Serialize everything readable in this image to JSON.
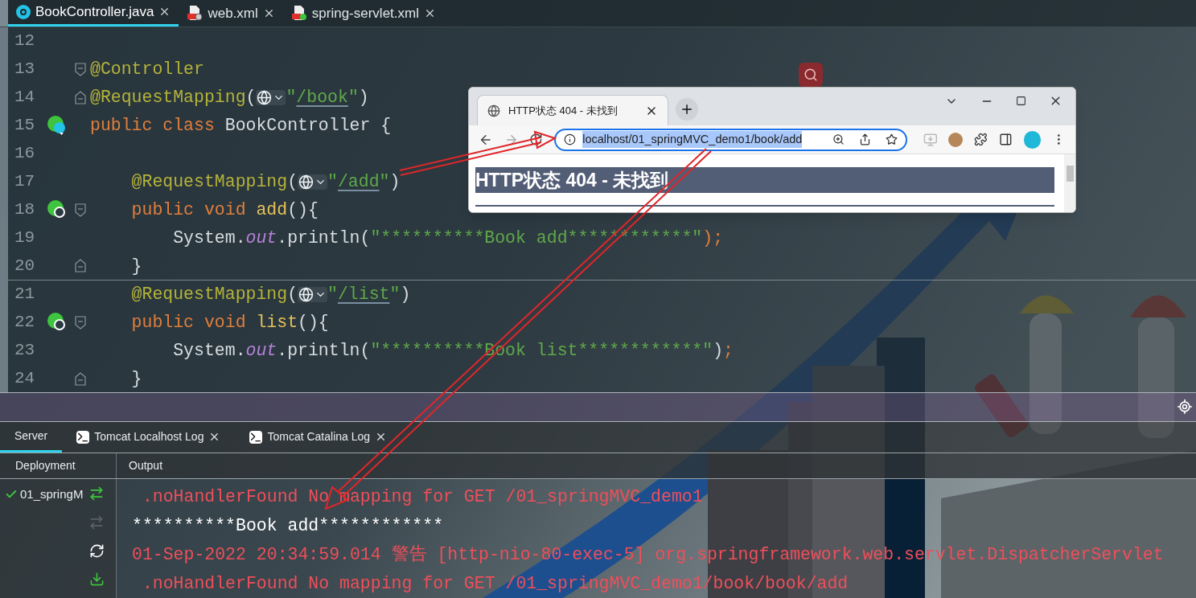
{
  "editor_tabs": [
    {
      "label": "BookController.java",
      "kind": "java",
      "selected": true
    },
    {
      "label": "web.xml",
      "kind": "web-xml",
      "selected": false
    },
    {
      "label": "spring-servlet.xml",
      "kind": "spring-xml",
      "selected": false
    }
  ],
  "code_lines": [
    {
      "number": "12"
    },
    {
      "number": "13",
      "fold": {
        "kind": "start"
      },
      "tokens": [
        {
          "kind": "annotation",
          "text": "@Controller"
        }
      ]
    },
    {
      "number": "14",
      "fold": {
        "kind": "end"
      },
      "tokens": [
        {
          "kind": "annotation",
          "text": "@RequestMapping"
        },
        {
          "kind": "plain",
          "text": "("
        },
        {
          "kind": "globe"
        },
        {
          "kind": "string",
          "text": "\""
        },
        {
          "kind": "link",
          "text": "/book"
        },
        {
          "kind": "string",
          "text": "\""
        },
        {
          "kind": "plain",
          "text": ")"
        }
      ]
    },
    {
      "number": "15",
      "gutter_icon": {
        "kind": "class"
      },
      "tokens": [
        {
          "kind": "keyword",
          "text": "public class "
        },
        {
          "kind": "plain",
          "text": "BookController {"
        }
      ]
    },
    {
      "number": "16"
    },
    {
      "number": "17",
      "tokens": [
        {
          "kind": "annotation",
          "text": "    @RequestMapping"
        },
        {
          "kind": "plain",
          "text": "("
        },
        {
          "kind": "globe"
        },
        {
          "kind": "string",
          "text": "\""
        },
        {
          "kind": "link",
          "text": "/add"
        },
        {
          "kind": "string",
          "text": "\""
        },
        {
          "kind": "plain",
          "text": ")"
        }
      ]
    },
    {
      "number": "18",
      "gutter_icon": {
        "kind": "web"
      },
      "fold": {
        "kind": "start"
      },
      "tokens": [
        {
          "kind": "keyword",
          "text": "    public void "
        },
        {
          "kind": "method",
          "text": "add"
        },
        {
          "kind": "plain",
          "text": "(){"
        }
      ]
    },
    {
      "number": "19",
      "tokens": [
        {
          "kind": "plain",
          "text": "        System."
        },
        {
          "kind": "field",
          "text": "out"
        },
        {
          "kind": "plain",
          "text": ".println("
        },
        {
          "kind": "string",
          "text": "\"**********Book add************\""
        },
        {
          "kind": "keyword",
          "text": ");"
        }
      ]
    },
    {
      "number": "20",
      "fold": {
        "kind": "end"
      },
      "separator": true,
      "tokens": [
        {
          "kind": "plain",
          "text": "    }"
        }
      ]
    },
    {
      "number": "21",
      "tokens": [
        {
          "kind": "annotation",
          "text": "    @RequestMapping"
        },
        {
          "kind": "plain",
          "text": "("
        },
        {
          "kind": "globe"
        },
        {
          "kind": "string",
          "text": "\""
        },
        {
          "kind": "link",
          "text": "/list"
        },
        {
          "kind": "string",
          "text": "\""
        },
        {
          "kind": "plain",
          "text": ")"
        }
      ]
    },
    {
      "number": "22",
      "gutter_icon": {
        "kind": "web"
      },
      "fold": {
        "kind": "start"
      },
      "tokens": [
        {
          "kind": "keyword",
          "text": "    public void "
        },
        {
          "kind": "method",
          "text": "list"
        },
        {
          "kind": "plain",
          "text": "(){"
        }
      ]
    },
    {
      "number": "23",
      "tokens": [
        {
          "kind": "plain",
          "text": "        System."
        },
        {
          "kind": "field",
          "text": "out"
        },
        {
          "kind": "plain",
          "text": ".println("
        },
        {
          "kind": "string",
          "text": "\"**********Book list************\""
        },
        {
          "kind": "plain",
          "text": ")"
        },
        {
          "kind": "keyword",
          "text": ";"
        }
      ]
    },
    {
      "number": "24",
      "fold": {
        "kind": "end"
      },
      "tokens": [
        {
          "kind": "plain",
          "text": "    }"
        }
      ]
    }
  ],
  "browser": {
    "tab_title": "HTTP状态 404 - 未找到",
    "url": "localhost/01_springMVC_demo1/book/add",
    "heading": "HTTP状态 404 - 未找到"
  },
  "panel_tabs": [
    {
      "label": "Server",
      "kind": "server",
      "selected": true
    },
    {
      "label": "Tomcat Localhost Log",
      "kind": "log",
      "selected": false
    },
    {
      "label": "Tomcat Catalina Log",
      "kind": "log",
      "selected": false
    }
  ],
  "columns": [
    "Deployment",
    "Output"
  ],
  "deployments": [
    {
      "label": "01_springM",
      "ok": true
    }
  ],
  "output_lines": [
    {
      "kind": "error",
      "text": " .noHandlerFound No mapping for GET /01_springMVC_demo1"
    },
    {
      "kind": "plain",
      "text": "**********Book add************"
    },
    {
      "kind": "error",
      "text": "01-Sep-2022 20:34:59.014 警告 [http-nio-80-exec-5] org.springframework.web.servlet.DispatcherServlet"
    },
    {
      "kind": "error",
      "text": " .noHandlerFound No mapping for GET /01_springMVC_demo1/book/book/add"
    }
  ]
}
